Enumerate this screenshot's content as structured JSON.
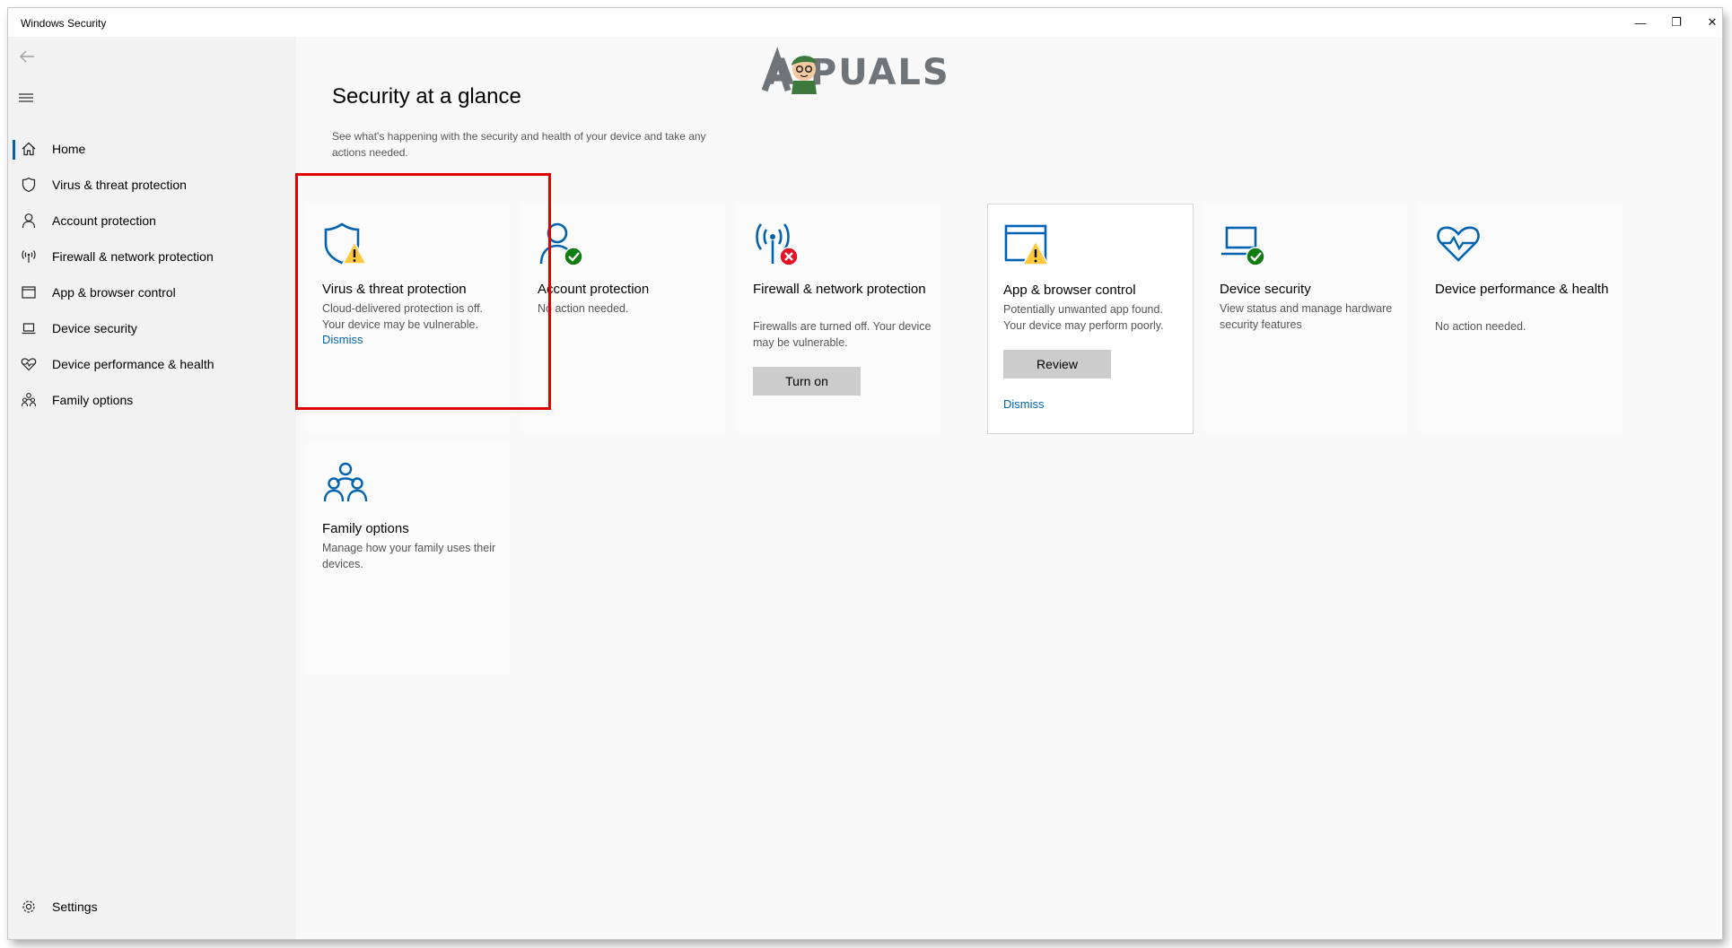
{
  "window": {
    "title": "Windows Security",
    "minimize": "—",
    "restore": "❐",
    "close": "✕"
  },
  "sidebar": {
    "back_icon": "back-arrow-icon",
    "menu_icon": "hamburger-icon",
    "items": [
      {
        "label": "Home",
        "icon": "home-icon",
        "selected": true
      },
      {
        "label": "Virus & threat protection",
        "icon": "shield-icon"
      },
      {
        "label": "Account protection",
        "icon": "person-icon"
      },
      {
        "label": "Firewall & network protection",
        "icon": "antenna-icon"
      },
      {
        "label": "App & browser control",
        "icon": "browser-window-icon"
      },
      {
        "label": "Device security",
        "icon": "laptop-icon"
      },
      {
        "label": "Device performance & health",
        "icon": "heart-icon"
      },
      {
        "label": "Family options",
        "icon": "family-icon"
      }
    ],
    "settings": {
      "label": "Settings",
      "icon": "gear-icon"
    }
  },
  "logo": {
    "text": "A  PUALS"
  },
  "main": {
    "title": "Security at a glance",
    "subtitle": "See what's happening with the security and health of your device and take any actions needed.",
    "cards": [
      {
        "title": "Virus & threat protection",
        "desc": "Cloud-delivered protection is off. Your device may be vulnerable.",
        "link": "Dismiss",
        "status": "warning"
      },
      {
        "title": "Account protection",
        "desc": "No action needed.",
        "status": "ok"
      },
      {
        "title": "Firewall & network protection",
        "desc": "Firewalls are turned off. Your device may be vulnerable.",
        "button": "Turn on",
        "status": "error"
      },
      {
        "title": "App & browser control",
        "desc": "Potentially unwanted app found. Your device may perform poorly.",
        "button": "Review",
        "link": "Dismiss",
        "status": "warning"
      },
      {
        "title": "Device security",
        "desc": "View status and manage hardware security features",
        "status": "ok"
      },
      {
        "title": "Device performance & health",
        "desc": "No action needed.",
        "status": "none"
      },
      {
        "title": "Family options",
        "desc": "Manage how your family uses their devices.",
        "status": "none"
      }
    ]
  },
  "colors": {
    "accent": "#0063b1",
    "warning": "#ffc83d",
    "ok": "#107c10",
    "error": "#e81123",
    "highlight": "#e00000"
  }
}
